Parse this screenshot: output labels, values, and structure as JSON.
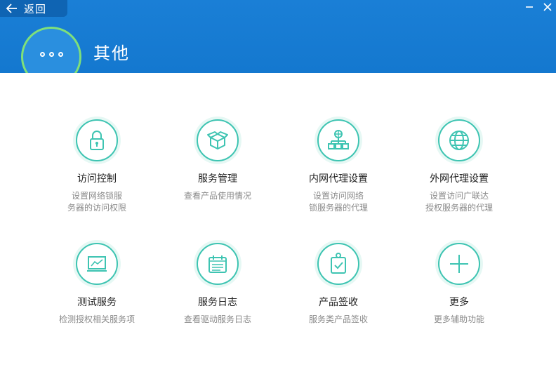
{
  "header": {
    "back_label": "返回",
    "title": "其他",
    "accent": "#1a7fd6",
    "ring_color": "#7fe07a"
  },
  "tiles": [
    {
      "name": "访问控制",
      "desc": "设置网络锁服\n务器的访问权限",
      "icon": "lock-icon"
    },
    {
      "name": "服务管理",
      "desc": "查看产品使用情况",
      "icon": "box-icon"
    },
    {
      "name": "内网代理设置",
      "desc": "设置访问网络\n锁服务器的代理",
      "icon": "network-tree-icon"
    },
    {
      "name": "外网代理设置",
      "desc": "设置访问广联达\n授权服务器的代理",
      "icon": "globe-icon"
    },
    {
      "name": "测试服务",
      "desc": "检测授权相关服务项",
      "icon": "monitor-chart-icon"
    },
    {
      "name": "服务日志",
      "desc": "查看驱动服务日志",
      "icon": "calendar-log-icon"
    },
    {
      "name": "产品签收",
      "desc": "服务类产品签收",
      "icon": "clipboard-check-icon"
    },
    {
      "name": "更多",
      "desc": "更多辅助功能",
      "icon": "plus-icon"
    }
  ],
  "colors": {
    "icon_teal": "#3ec4b2",
    "ring_bg": "#e6f8f4",
    "text": "#222222",
    "subtext": "#8a8a8a"
  }
}
